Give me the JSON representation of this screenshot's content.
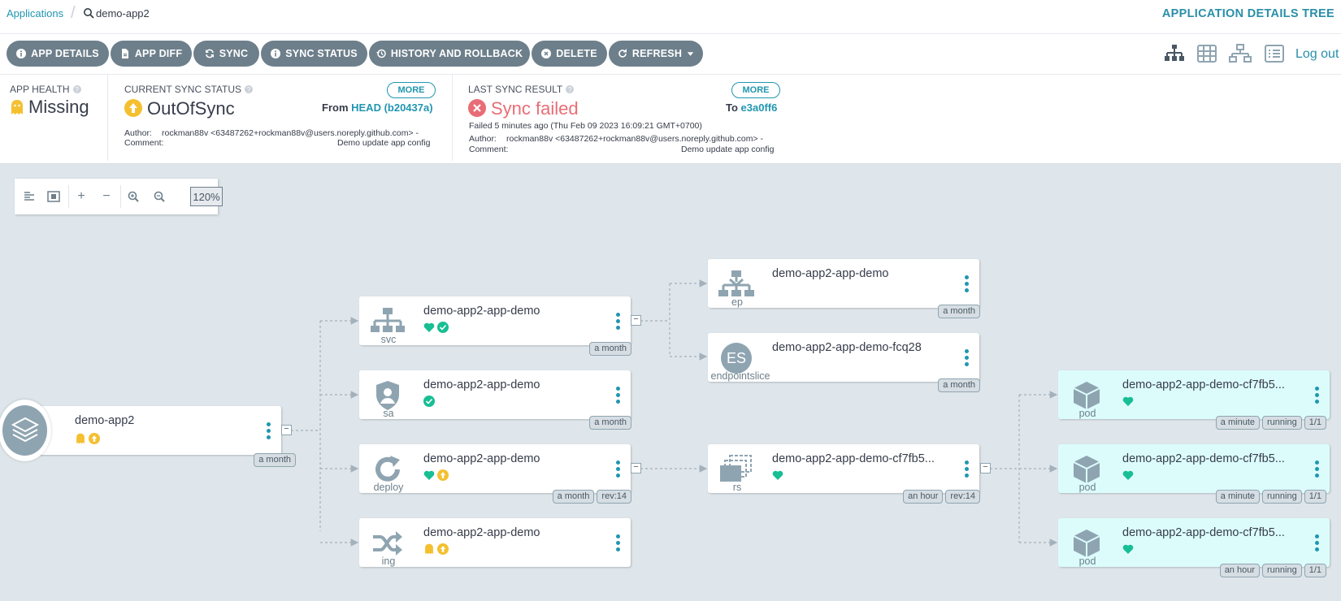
{
  "breadcrumb": {
    "applications": "Applications",
    "current": "demo-app2"
  },
  "page_title": "APPLICATION DETAILS TREE",
  "toolbar": {
    "buttons": [
      "APP DETAILS",
      "APP DIFF",
      "SYNC",
      "SYNC STATUS",
      "HISTORY AND ROLLBACK",
      "DELETE",
      "REFRESH"
    ],
    "logout": "Log out"
  },
  "health": {
    "label": "APP HEALTH",
    "value": "Missing"
  },
  "sync_status": {
    "label": "CURRENT SYNC STATUS",
    "value": "OutOfSync",
    "more": "MORE",
    "from_prefix": "From",
    "revision": "HEAD (b20437a)",
    "author_label": "Author:",
    "author": "rockman88v <63487262+rockman88v@users.noreply.github.com> -",
    "comment_label": "Comment:",
    "comment": "Demo update app config"
  },
  "last_sync": {
    "label": "LAST SYNC RESULT",
    "value": "Sync failed",
    "more": "MORE",
    "to_prefix": "To",
    "revision": "e3a0ff6",
    "failed": "Failed 5 minutes ago (Thu Feb 09 2023 16:09:21 GMT+0700)",
    "author_label": "Author:",
    "author": "rockman88v <63487262+rockman88v@users.noreply.github.com> -",
    "comment_label": "Comment:",
    "comment": "Demo update app config"
  },
  "zoom": "120%",
  "colors": {
    "teal": "#2196b0",
    "healthy": "#18be94",
    "warning": "#f4c030",
    "failed": "#e96d76"
  },
  "nodes": {
    "app": {
      "title": "demo-app2",
      "badges": [
        "a month"
      ]
    },
    "svc": {
      "title": "demo-app2-app-demo",
      "kind": "svc",
      "badges": [
        "a month"
      ]
    },
    "sa": {
      "title": "demo-app2-app-demo",
      "kind": "sa",
      "badges": [
        "a month"
      ]
    },
    "deploy": {
      "title": "demo-app2-app-demo",
      "kind": "deploy",
      "badges": [
        "a month",
        "rev:14"
      ]
    },
    "ing": {
      "title": "demo-app2-app-demo",
      "kind": "ing"
    },
    "ep": {
      "title": "demo-app2-app-demo",
      "kind": "ep",
      "badges": [
        "a month"
      ]
    },
    "es": {
      "title": "demo-app2-app-demo-fcq28",
      "kind": "endpointslice",
      "icon_text": "ES",
      "badges": [
        "a month"
      ]
    },
    "rs": {
      "title": "demo-app2-app-demo-cf7fb5...",
      "kind": "rs",
      "badges": [
        "an hour",
        "rev:14"
      ]
    },
    "pod1": {
      "title": "demo-app2-app-demo-cf7fb5...",
      "kind": "pod",
      "badges": [
        "a minute",
        "running",
        "1/1"
      ]
    },
    "pod2": {
      "title": "demo-app2-app-demo-cf7fb5...",
      "kind": "pod",
      "badges": [
        "a minute",
        "running",
        "1/1"
      ]
    },
    "pod3": {
      "title": "demo-app2-app-demo-cf7fb5...",
      "kind": "pod",
      "badges": [
        "an hour",
        "running",
        "1/1"
      ]
    }
  }
}
